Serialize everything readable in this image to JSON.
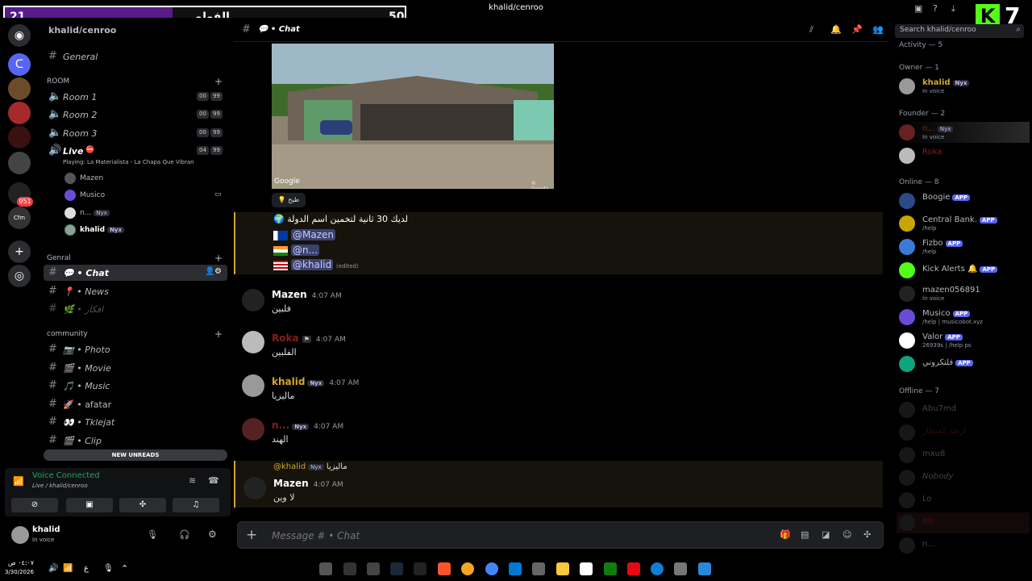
{
  "window": {
    "title": "khalid/cenroo"
  },
  "overlay": {
    "left_score": "21",
    "right_score": "50",
    "label": "الفولو",
    "progress_fraction": 0.42
  },
  "kick_count": "7",
  "server": {
    "name": "khalid/cenroo"
  },
  "sidebar": {
    "top_channel": "General",
    "cat_room": "ROOM",
    "voice_rooms": [
      {
        "name": "Room 1",
        "count": "00",
        "limit": "99"
      },
      {
        "name": "Room 2",
        "count": "00",
        "limit": "99"
      },
      {
        "name": "Room 3",
        "count": "00",
        "limit": "99"
      },
      {
        "name": "Live",
        "count": "04",
        "limit": "99"
      }
    ],
    "live_status": "Playing: La Materialista - La Chapa Que Vibran",
    "live_users": [
      "Mazen",
      "Musico",
      "n...",
      "khalid"
    ],
    "cat_general": "Genral",
    "general_channels": [
      "Chat",
      "News",
      "افكار"
    ],
    "cat_community": "community",
    "community_channels": [
      "Photo",
      "Movie",
      "Music",
      "afatar",
      "Tklejat",
      "Clip"
    ],
    "new_unreads": "NEW UNREADS"
  },
  "voice": {
    "status": "Voice Connected",
    "location": "Live / khalid/cenroo"
  },
  "user": {
    "name": "khalid",
    "status": "In voice"
  },
  "chat": {
    "channel_title": "Chat",
    "search_placeholder": "Search khalid/cenroo",
    "reaction_label": "طيح",
    "bot_message": "لديك 30 ثانية لتخمين اسم الدولة",
    "mentions": [
      "@Mazen",
      "@n...",
      "@khalid"
    ],
    "edited": "(edited)",
    "messages": [
      {
        "author": "Mazen",
        "time": "4:07 AM",
        "text": "فلبين"
      },
      {
        "author": "Roka",
        "time": "4:07 AM",
        "text": "الفلبين"
      },
      {
        "author": "khalid",
        "badge": "Nyx",
        "time": "4:07 AM",
        "text": "ماليزيا"
      },
      {
        "author": "n...",
        "badge": "Nyx",
        "time": "4:07 AM",
        "text": "الهند"
      },
      {
        "author": "Mazen",
        "time": "4:07 AM",
        "text": "لا وين",
        "reply_to": "@khalid",
        "reply_badge": "Nyx",
        "reply_text": "ماليزيا"
      }
    ],
    "composer_placeholder": "Message # • Chat",
    "image_credit": "Google",
    "image_credit2": "© Google"
  },
  "members": {
    "activity_header": "Activity — 5",
    "owner_header": "Owner — 1",
    "owner": {
      "name": "khalid",
      "badge": "Nyx",
      "sub": "In voice"
    },
    "founder_header": "Founder — 2",
    "founders": [
      {
        "name": "n...",
        "badge": "Nyx",
        "sub": "In voice"
      },
      {
        "name": "Roka",
        "sub": ""
      }
    ],
    "online_header": "Online — 8",
    "online": [
      {
        "name": "Boogie",
        "app": "APP",
        "sub": ""
      },
      {
        "name": "Central Bank.",
        "app": "APP",
        "sub": "/help"
      },
      {
        "name": "Fizbo",
        "app": "APP",
        "sub": "/help"
      },
      {
        "name": "Kick Alerts",
        "app": "APP",
        "sub": ""
      },
      {
        "name": "mazen056891",
        "sub": "In voice"
      },
      {
        "name": "Musico",
        "app": "APP",
        "sub": "/help | musicobot.xyz"
      },
      {
        "name": "Valor",
        "app": "APP",
        "sub": "26939s | /help ps"
      },
      {
        "name": "فلتكروني",
        "app": "APP",
        "sub": ""
      }
    ],
    "offline_header": "Offline — 7",
    "offline": [
      "Abu7md",
      "ارطه الفنظار",
      "mxu8",
      "Nobody",
      "Lo",
      "Mo",
      "n..."
    ]
  },
  "taskbar": {
    "time": "٠٤:٠٧ ص",
    "date": "3/30/2026",
    "lang": "ع"
  }
}
